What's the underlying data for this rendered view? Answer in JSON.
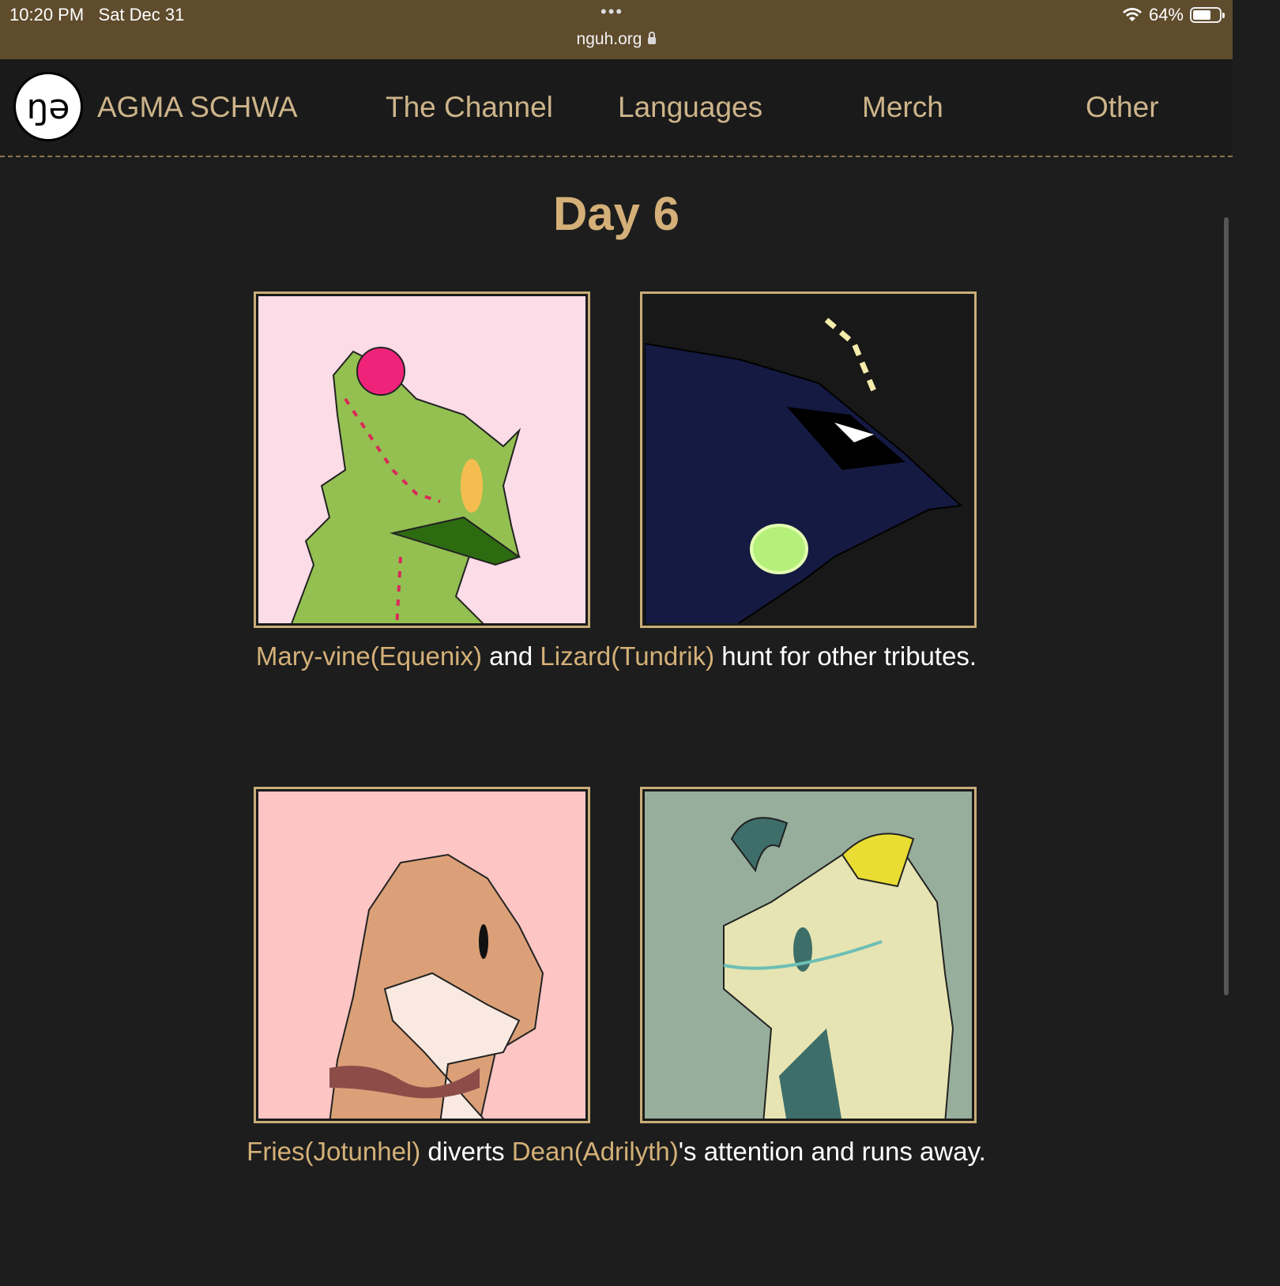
{
  "status_bar": {
    "time": "10:20 PM",
    "date": "Sat Dec 31",
    "battery": "64%",
    "url": "nguh.org",
    "menu_dots": "•••",
    "icons": [
      "wifi-icon",
      "battery-icon",
      "lock-icon"
    ]
  },
  "nav": {
    "logo_glyph": "ŋə",
    "brand": "AGMA SCHWA",
    "links": [
      "The Channel",
      "Languages",
      "Merch",
      "Other"
    ]
  },
  "page": {
    "title": "Day 6"
  },
  "events": [
    {
      "parts": [
        {
          "text": "Mary-vine(Equenix)",
          "kind": "name"
        },
        {
          "text": " and ",
          "kind": "plain"
        },
        {
          "text": "Lizard(Tundrik)",
          "kind": "name"
        },
        {
          "text": " hunt for other tributes.",
          "kind": "plain"
        }
      ]
    },
    {
      "parts": [
        {
          "text": "Fries(Jotunhel)",
          "kind": "name"
        },
        {
          "text": " diverts ",
          "kind": "plain"
        },
        {
          "text": "Dean(Adrilyth)",
          "kind": "name"
        },
        {
          "text": "'s attention and runs away.",
          "kind": "plain"
        }
      ]
    }
  ],
  "colors": {
    "background": "#1d1d1d",
    "accent": "#d4b078",
    "status_bar": "#5f4c2d"
  }
}
